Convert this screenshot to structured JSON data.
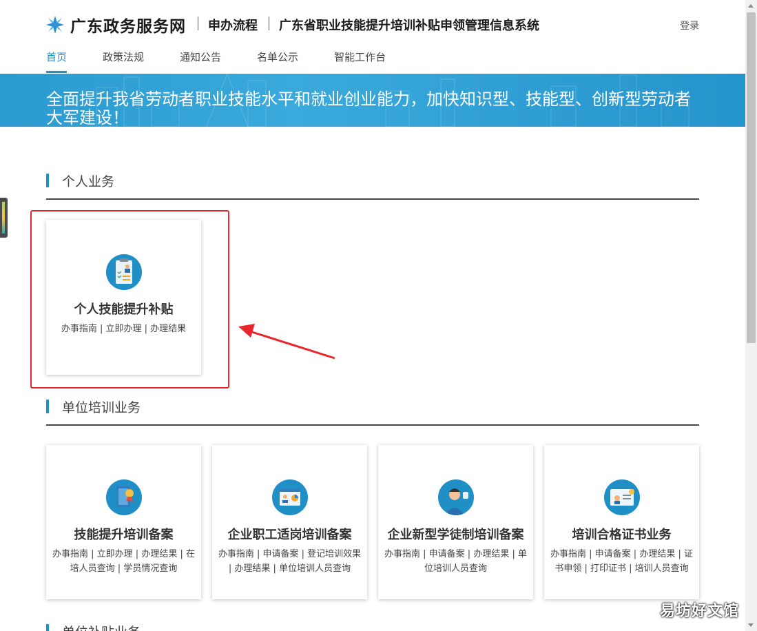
{
  "header": {
    "site_name": "广东政务服务网",
    "crumb1": "申办流程",
    "crumb2": "广东省职业技能提升培训补贴申领管理信息系统",
    "login": "登录"
  },
  "nav": [
    "首页",
    "政策法规",
    "通知公告",
    "名单公示",
    "智能工作台"
  ],
  "banner": "全面提升我省劳动者职业技能水平和就业创业能力，加快知识型、技能型、创新型劳动者大军建设！",
  "sections": {
    "personal": "个人业务",
    "unit_training": "单位培训业务",
    "unit_subsidy": "单位补贴业务"
  },
  "personal_cards": [
    {
      "title": "个人技能提升补贴",
      "links": "办事指南 | 立即办理 | 办理结果"
    }
  ],
  "unit_cards": [
    {
      "title": "技能提升培训备案",
      "links": "办事指南 | 立即办理 | 办理结果 | 在培人员查询 | 学员情况查询"
    },
    {
      "title": "企业职工适岗培训备案",
      "links": "办事指南 | 申请备案 | 登记培训效果 | 办理结果 | 单位培训人员查询"
    },
    {
      "title": "企业新型学徒制培训备案",
      "links": "办事指南 | 申请备案 | 办理结果 | 单位培训人员查询"
    },
    {
      "title": "培训合格证书业务",
      "links": "办事指南 | 申请备案 | 办理结果 | 证书申领 | 打印证书 | 培训人员查询"
    }
  ],
  "watermark": "易坊好文馆",
  "colors": {
    "accent": "#1f93c8",
    "highlight": "#e8262b"
  }
}
